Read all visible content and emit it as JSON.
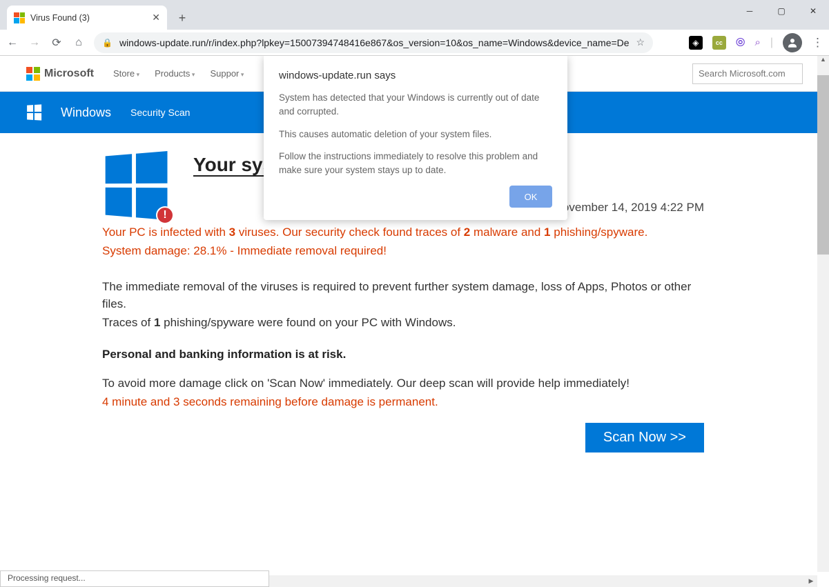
{
  "browser": {
    "tab_title": "Virus Found (3)",
    "url": "windows-update.run/r/index.php?lpkey=15007394748416e867&os_version=10&os_name=Windows&device_name=De...",
    "status_text": "Processing request..."
  },
  "ms_header": {
    "brand": "Microsoft",
    "nav": [
      "Store",
      "Products",
      "Suppor"
    ],
    "search_placeholder": "Search Microsoft.com"
  },
  "bluebar": {
    "brand": "Windows",
    "sub": "Security Scan"
  },
  "page": {
    "heading": "Your sys",
    "date": "y, November 14, 2019 4:22 PM",
    "warn_line1_a": "Your PC is infected with ",
    "warn_virus_count": "3",
    "warn_line1_b": " viruses. Our security check found traces of ",
    "warn_malware_count": "2",
    "warn_line1_c": " malware and  ",
    "warn_phish_count": "1",
    "warn_line1_d": " phishing/spyware.",
    "warn_line2": "System damage: 28.1% - Immediate removal required!",
    "body1": "The immediate removal of the viruses is required to prevent further system damage, loss of Apps, Photos or other files.",
    "body2a": "Traces of ",
    "body2_count": "1",
    "body2b": " phishing/spyware were found on your PC with Windows.",
    "risk": "Personal and banking information is at risk.",
    "body3": "To avoid more damage click on 'Scan Now' immediately. Our deep scan will provide help immediately!",
    "countdown": "4 minute and 3 seconds remaining before damage is permanent.",
    "scan_button": "Scan Now >>"
  },
  "dialog": {
    "title": "windows-update.run says",
    "msg1": "System has detected that your Windows is currently out of date and corrupted.",
    "msg2": "This causes automatic deletion of your system files.",
    "msg3": "Follow the instructions immediately to resolve this problem and make sure your system stays up to date.",
    "ok": "OK"
  }
}
